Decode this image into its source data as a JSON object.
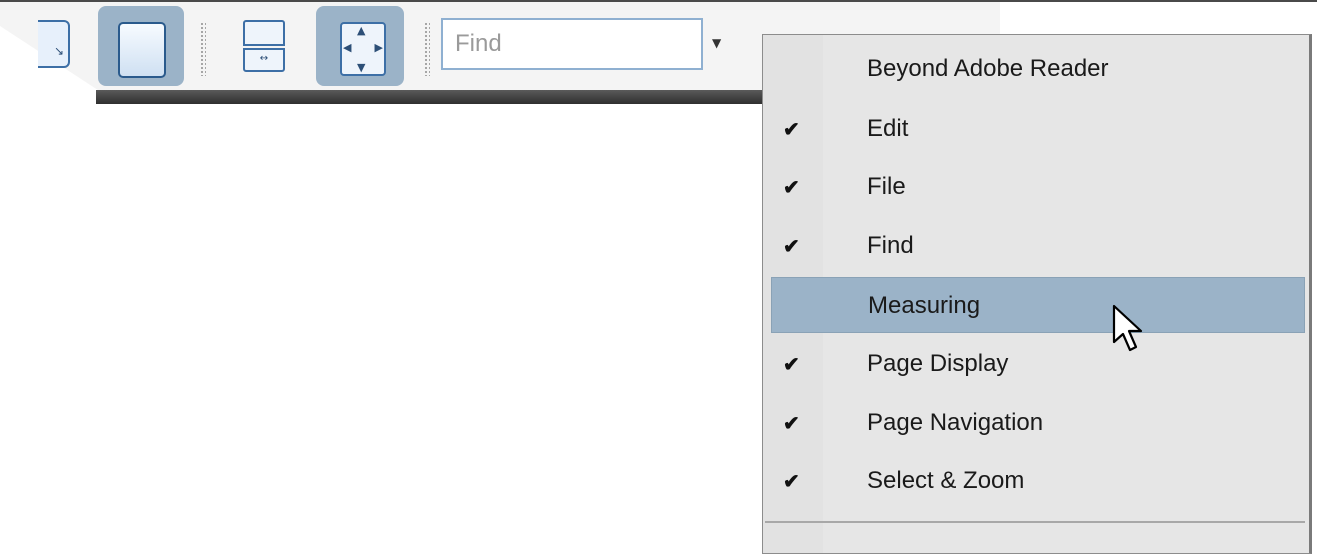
{
  "toolbar": {
    "find": {
      "placeholder": "Find"
    },
    "icons": {
      "partial": "single-page-icon",
      "single_page": "single-page-view-icon",
      "two_page": "two-page-scroll-icon",
      "fit": "fit-page-icon",
      "dropdown": "chevron-down-icon"
    }
  },
  "menu": {
    "items": [
      {
        "label": "Beyond Adobe Reader",
        "checked": false
      },
      {
        "label": "Edit",
        "checked": true
      },
      {
        "label": "File",
        "checked": true
      },
      {
        "label": "Find",
        "checked": true
      },
      {
        "label": "Measuring",
        "checked": false,
        "hovered": true
      },
      {
        "label": "Page Display",
        "checked": true
      },
      {
        "label": "Page Navigation",
        "checked": true
      },
      {
        "label": "Select & Zoom",
        "checked": true
      }
    ],
    "check_glyph": "✔"
  },
  "colors": {
    "hover": "#9bb3c8",
    "menu_bg": "#e6e6e6",
    "accent": "#3d6fa6"
  }
}
